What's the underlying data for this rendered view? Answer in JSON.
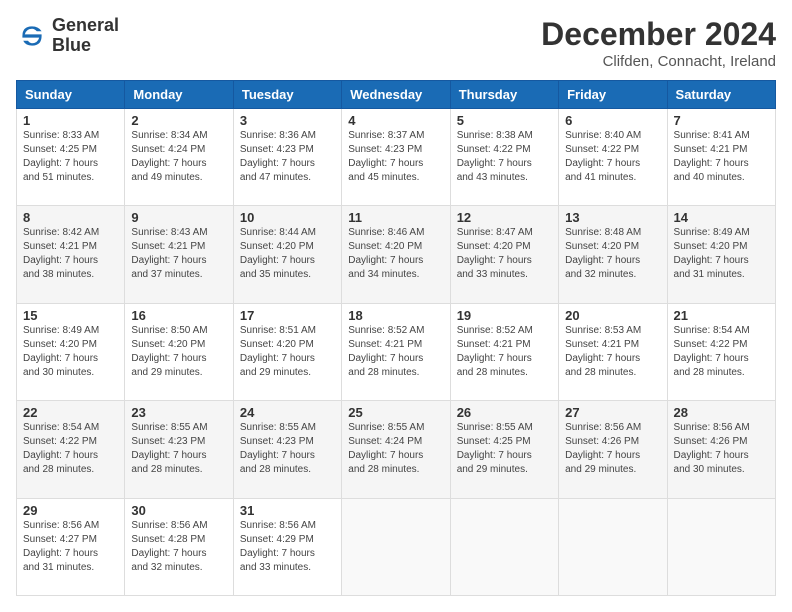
{
  "logo": {
    "line1": "General",
    "line2": "Blue"
  },
  "title": "December 2024",
  "subtitle": "Clifden, Connacht, Ireland",
  "days_header": [
    "Sunday",
    "Monday",
    "Tuesday",
    "Wednesday",
    "Thursday",
    "Friday",
    "Saturday"
  ],
  "weeks": [
    [
      {
        "day": "1",
        "info": "Sunrise: 8:33 AM\nSunset: 4:25 PM\nDaylight: 7 hours\nand 51 minutes."
      },
      {
        "day": "2",
        "info": "Sunrise: 8:34 AM\nSunset: 4:24 PM\nDaylight: 7 hours\nand 49 minutes."
      },
      {
        "day": "3",
        "info": "Sunrise: 8:36 AM\nSunset: 4:23 PM\nDaylight: 7 hours\nand 47 minutes."
      },
      {
        "day": "4",
        "info": "Sunrise: 8:37 AM\nSunset: 4:23 PM\nDaylight: 7 hours\nand 45 minutes."
      },
      {
        "day": "5",
        "info": "Sunrise: 8:38 AM\nSunset: 4:22 PM\nDaylight: 7 hours\nand 43 minutes."
      },
      {
        "day": "6",
        "info": "Sunrise: 8:40 AM\nSunset: 4:22 PM\nDaylight: 7 hours\nand 41 minutes."
      },
      {
        "day": "7",
        "info": "Sunrise: 8:41 AM\nSunset: 4:21 PM\nDaylight: 7 hours\nand 40 minutes."
      }
    ],
    [
      {
        "day": "8",
        "info": "Sunrise: 8:42 AM\nSunset: 4:21 PM\nDaylight: 7 hours\nand 38 minutes."
      },
      {
        "day": "9",
        "info": "Sunrise: 8:43 AM\nSunset: 4:21 PM\nDaylight: 7 hours\nand 37 minutes."
      },
      {
        "day": "10",
        "info": "Sunrise: 8:44 AM\nSunset: 4:20 PM\nDaylight: 7 hours\nand 35 minutes."
      },
      {
        "day": "11",
        "info": "Sunrise: 8:46 AM\nSunset: 4:20 PM\nDaylight: 7 hours\nand 34 minutes."
      },
      {
        "day": "12",
        "info": "Sunrise: 8:47 AM\nSunset: 4:20 PM\nDaylight: 7 hours\nand 33 minutes."
      },
      {
        "day": "13",
        "info": "Sunrise: 8:48 AM\nSunset: 4:20 PM\nDaylight: 7 hours\nand 32 minutes."
      },
      {
        "day": "14",
        "info": "Sunrise: 8:49 AM\nSunset: 4:20 PM\nDaylight: 7 hours\nand 31 minutes."
      }
    ],
    [
      {
        "day": "15",
        "info": "Sunrise: 8:49 AM\nSunset: 4:20 PM\nDaylight: 7 hours\nand 30 minutes."
      },
      {
        "day": "16",
        "info": "Sunrise: 8:50 AM\nSunset: 4:20 PM\nDaylight: 7 hours\nand 29 minutes."
      },
      {
        "day": "17",
        "info": "Sunrise: 8:51 AM\nSunset: 4:20 PM\nDaylight: 7 hours\nand 29 minutes."
      },
      {
        "day": "18",
        "info": "Sunrise: 8:52 AM\nSunset: 4:21 PM\nDaylight: 7 hours\nand 28 minutes."
      },
      {
        "day": "19",
        "info": "Sunrise: 8:52 AM\nSunset: 4:21 PM\nDaylight: 7 hours\nand 28 minutes."
      },
      {
        "day": "20",
        "info": "Sunrise: 8:53 AM\nSunset: 4:21 PM\nDaylight: 7 hours\nand 28 minutes."
      },
      {
        "day": "21",
        "info": "Sunrise: 8:54 AM\nSunset: 4:22 PM\nDaylight: 7 hours\nand 28 minutes."
      }
    ],
    [
      {
        "day": "22",
        "info": "Sunrise: 8:54 AM\nSunset: 4:22 PM\nDaylight: 7 hours\nand 28 minutes."
      },
      {
        "day": "23",
        "info": "Sunrise: 8:55 AM\nSunset: 4:23 PM\nDaylight: 7 hours\nand 28 minutes."
      },
      {
        "day": "24",
        "info": "Sunrise: 8:55 AM\nSunset: 4:23 PM\nDaylight: 7 hours\nand 28 minutes."
      },
      {
        "day": "25",
        "info": "Sunrise: 8:55 AM\nSunset: 4:24 PM\nDaylight: 7 hours\nand 28 minutes."
      },
      {
        "day": "26",
        "info": "Sunrise: 8:55 AM\nSunset: 4:25 PM\nDaylight: 7 hours\nand 29 minutes."
      },
      {
        "day": "27",
        "info": "Sunrise: 8:56 AM\nSunset: 4:26 PM\nDaylight: 7 hours\nand 29 minutes."
      },
      {
        "day": "28",
        "info": "Sunrise: 8:56 AM\nSunset: 4:26 PM\nDaylight: 7 hours\nand 30 minutes."
      }
    ],
    [
      {
        "day": "29",
        "info": "Sunrise: 8:56 AM\nSunset: 4:27 PM\nDaylight: 7 hours\nand 31 minutes."
      },
      {
        "day": "30",
        "info": "Sunrise: 8:56 AM\nSunset: 4:28 PM\nDaylight: 7 hours\nand 32 minutes."
      },
      {
        "day": "31",
        "info": "Sunrise: 8:56 AM\nSunset: 4:29 PM\nDaylight: 7 hours\nand 33 minutes."
      },
      {
        "day": "",
        "info": ""
      },
      {
        "day": "",
        "info": ""
      },
      {
        "day": "",
        "info": ""
      },
      {
        "day": "",
        "info": ""
      }
    ]
  ]
}
